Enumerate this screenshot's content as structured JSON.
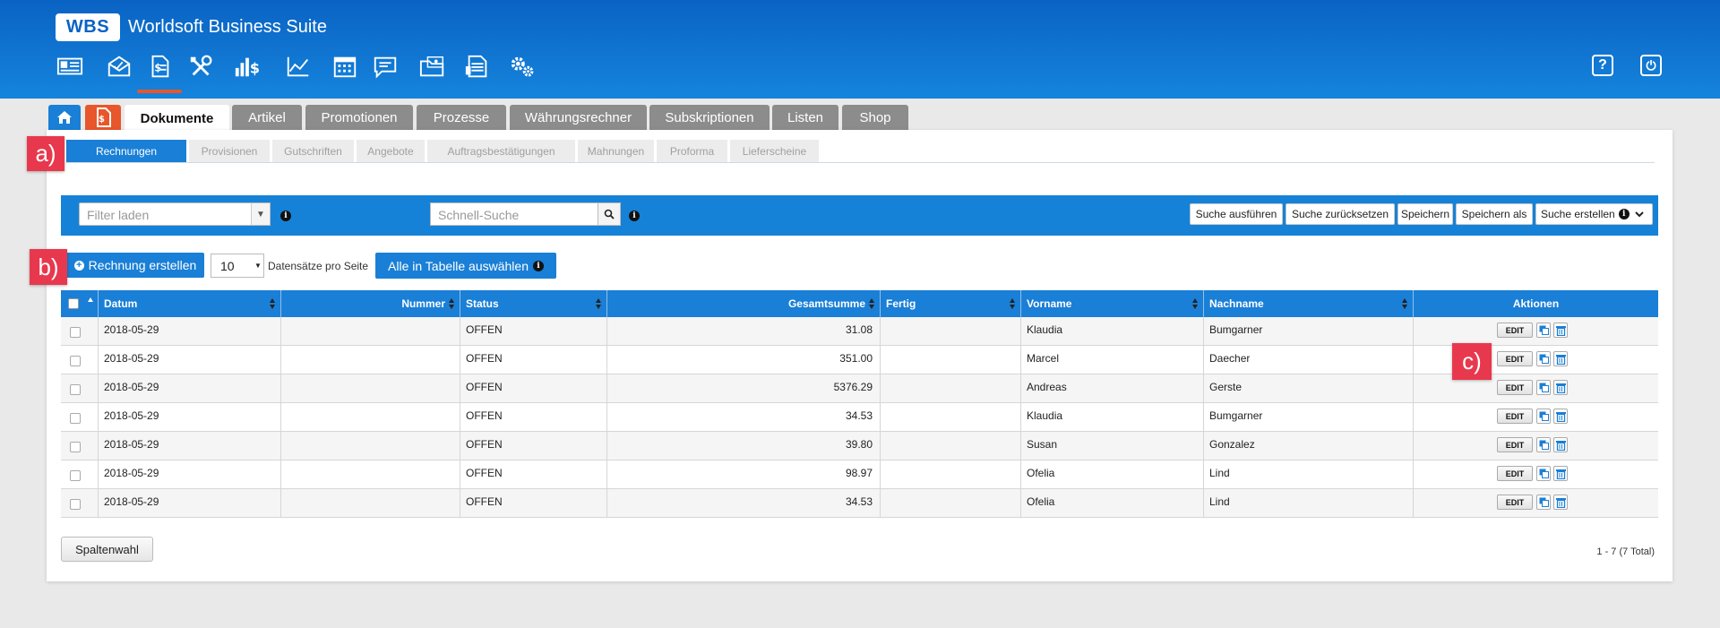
{
  "app": {
    "logo": "WBS",
    "title": "Worldsoft Business Suite"
  },
  "header": {
    "nav_icons": [
      "contact-card-icon",
      "mail-icon",
      "document-dollar-icon",
      "tools-icon",
      "revenue-icon",
      "line-chart-icon",
      "calendar-icon",
      "message-icon",
      "media-folder-icon",
      "newsletter-icon",
      "settings-icon"
    ],
    "active_icon": "document-dollar-icon",
    "right_icons": [
      "help-icon",
      "power-icon"
    ],
    "help_glyph": "?",
    "power_glyph": "⏻"
  },
  "main_tabs": [
    "Dokumente",
    "Artikel",
    "Promotionen",
    "Prozesse",
    "Währungsrechner",
    "Subskriptionen",
    "Listen",
    "Shop"
  ],
  "sub_tabs": [
    "Rechnungen",
    "Provisionen",
    "Gutschriften",
    "Angebote",
    "Auftragsbestätigungen",
    "Mahnungen",
    "Proforma",
    "Lieferscheine"
  ],
  "markers": {
    "a": "a)",
    "b": "b)",
    "c": "c)"
  },
  "filter_bar": {
    "filter_placeholder": "Filter laden",
    "search_placeholder": "Schnell-Suche",
    "buttons": [
      "Suche ausführen",
      "Suche zurücksetzen",
      "Speichern",
      "Speichern als",
      "Suche erstellen"
    ],
    "info_glyph": "i"
  },
  "actions": {
    "create_label": "Rechnung erstellen",
    "per_page_value": "10",
    "per_page_label": "Datensätze pro Seite",
    "select_all_label": "Alle in Tabelle auswählen"
  },
  "table": {
    "columns": [
      "Datum",
      "Nummer",
      "Status",
      "Gesamtsumme",
      "Fertig",
      "Vorname",
      "Nachname",
      "Aktionen"
    ],
    "edit_label": "EDIT",
    "rows": [
      [
        "2018-05-29",
        "",
        "OFFEN",
        "31.08",
        "",
        "Klaudia",
        "Bumgarner"
      ],
      [
        "2018-05-29",
        "",
        "OFFEN",
        "351.00",
        "",
        "Marcel",
        "Daecher"
      ],
      [
        "2018-05-29",
        "",
        "OFFEN",
        "5376.29",
        "",
        "Andreas",
        "Gerste"
      ],
      [
        "2018-05-29",
        "",
        "OFFEN",
        "34.53",
        "",
        "Klaudia",
        "Bumgarner"
      ],
      [
        "2018-05-29",
        "",
        "OFFEN",
        "39.80",
        "",
        "Susan",
        "Gonzalez"
      ],
      [
        "2018-05-29",
        "",
        "OFFEN",
        "98.97",
        "",
        "Ofelia",
        "Lind"
      ],
      [
        "2018-05-29",
        "",
        "OFFEN",
        "34.53",
        "",
        "Ofelia",
        "Lind"
      ]
    ]
  },
  "footer": {
    "column_button": "Spaltenwahl",
    "pager_text": "1 - 7 (7 Total)"
  },
  "colors": {
    "header_blue": "#0a63c4",
    "accent_blue": "#1a7fd6",
    "accent_orange": "#e8562b",
    "marker_red": "#e8384d"
  }
}
